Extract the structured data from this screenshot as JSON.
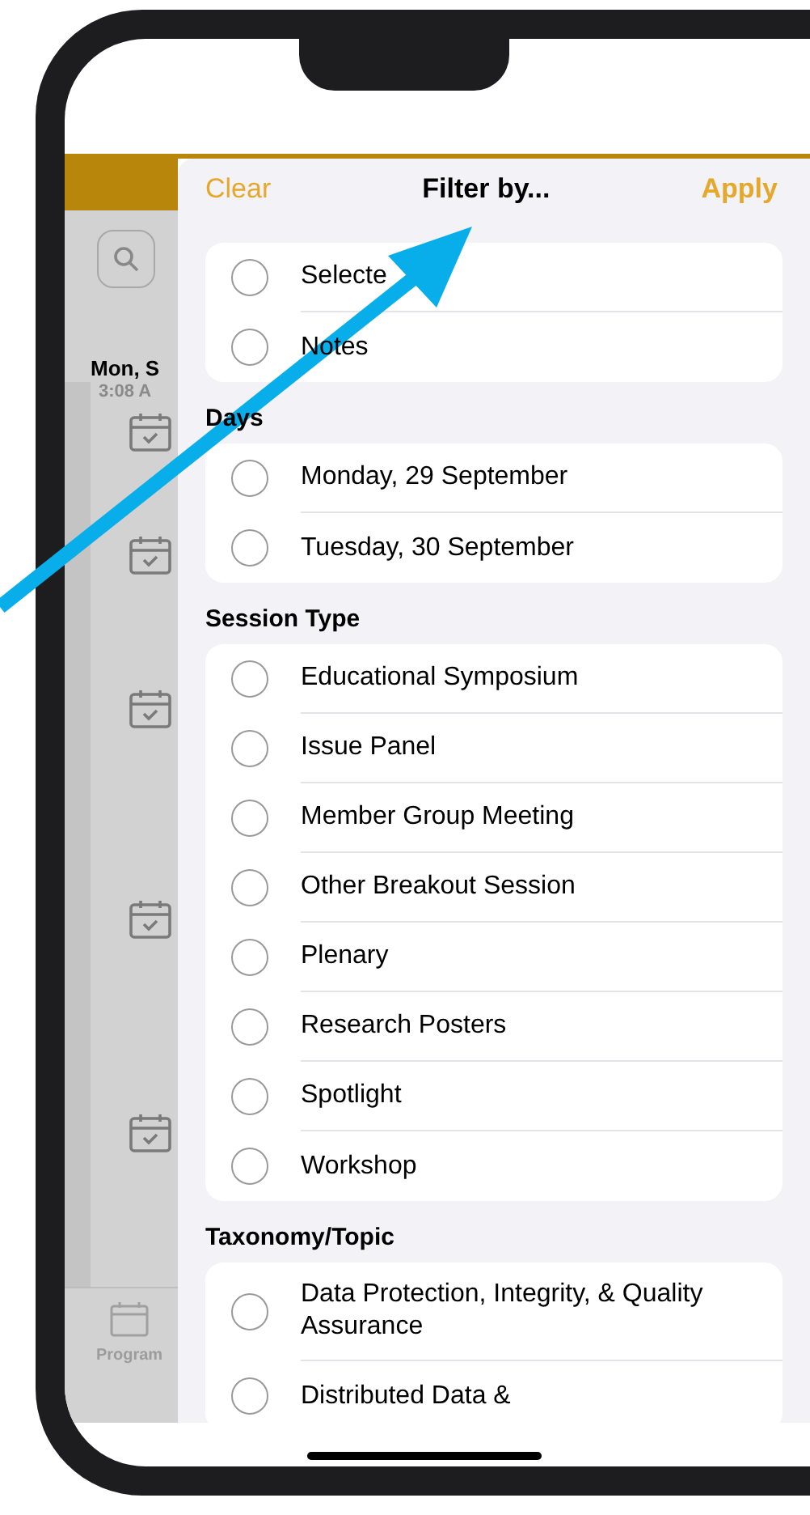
{
  "background": {
    "date": "Mon, S",
    "time": "3:08 A",
    "tab": "Program"
  },
  "header": {
    "clear": "Clear",
    "title": "Filter by...",
    "apply": "Apply"
  },
  "sections": [
    {
      "options": [
        {
          "label": "Selecte",
          "selected": false
        },
        {
          "label": "Notes",
          "selected": false
        }
      ]
    },
    {
      "title": "Days",
      "options": [
        {
          "label": "Monday, 29 September",
          "selected": false
        },
        {
          "label": "Tuesday, 30 September",
          "selected": false
        }
      ]
    },
    {
      "title": "Session Type",
      "options": [
        {
          "label": "Educational Symposium",
          "selected": false
        },
        {
          "label": "Issue Panel",
          "selected": false
        },
        {
          "label": "Member Group Meeting",
          "selected": false
        },
        {
          "label": "Other Breakout Session",
          "selected": false
        },
        {
          "label": "Plenary",
          "selected": false
        },
        {
          "label": "Research Posters",
          "selected": false
        },
        {
          "label": "Spotlight",
          "selected": false
        },
        {
          "label": "Workshop",
          "selected": false
        }
      ]
    },
    {
      "title": "Taxonomy/Topic",
      "options": [
        {
          "label": "Data Protection, Integrity, & Quality Assurance",
          "selected": false
        },
        {
          "label": "Distributed Data &",
          "selected": false
        }
      ]
    }
  ]
}
